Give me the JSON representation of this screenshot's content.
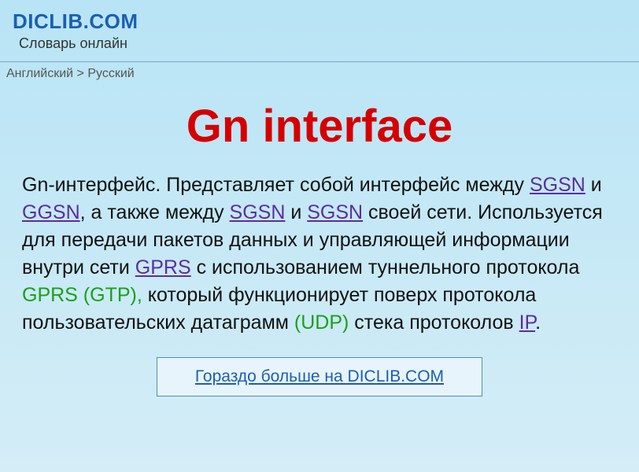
{
  "header": {
    "logo": "DICLIB.COM",
    "tagline": "Словарь онлайн"
  },
  "breadcrumb": {
    "from": "Английский",
    "separator": ">",
    "to": "Русский"
  },
  "article": {
    "title": "Gn interface",
    "body": {
      "part1": "Gn-интерфейс. Представляет собой интерфейс между ",
      "link_sgsn1": "SGSN",
      "part2": " и ",
      "link_ggsn": "GGSN",
      "part3": ", а также между ",
      "link_sgsn2": "SGSN",
      "part4": " и ",
      "link_sgsn3": "SGSN",
      "part5": " своей сети. Используется для передачи пакетов данных и управляющей информации внутри сети ",
      "link_gprs": "GPRS",
      "part6": " с использованием туннельного протокола ",
      "green_gprs_gtp": "GPRS (GTP),",
      "part7": " который функционирует поверх протокола пользовательских датаграмм ",
      "green_udp": "(UDP)",
      "part8": " стека протоколов ",
      "link_ip": "IP",
      "part9": "."
    }
  },
  "cta": {
    "label": "Гораздо больше на DICLIB.COM"
  }
}
